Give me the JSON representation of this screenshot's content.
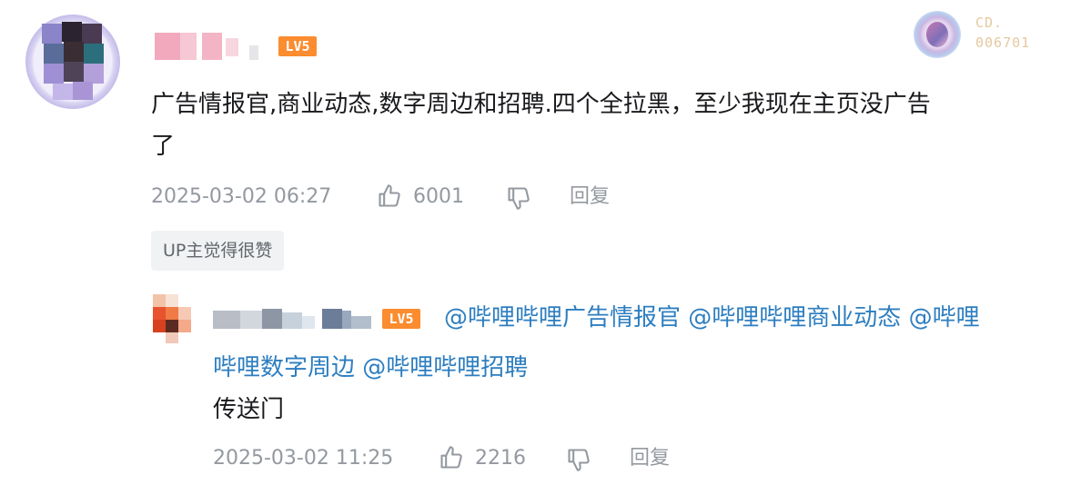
{
  "comment": {
    "level_badge": "LV5",
    "fan_badge_number": "CD.\n006701",
    "text_line1": "广告情报官,商业动态,数字周边和招聘.四个全拉黑，至少我现在主页没广告",
    "text_line2": "了",
    "timestamp": "2025-03-02 06:27",
    "like_count": "6001",
    "reply_label": "回复",
    "up_liked_tag": "UP主觉得很赞"
  },
  "reply": {
    "level_badge": "LV5",
    "mention_1": "@哔哩哔哩广告情报官",
    "mention_2": "@哔哩哔哩商业动态",
    "mention_3_part1": "@哔哩",
    "mention_3_part2": "哔哩数字周边",
    "mention_4": "@哔哩哔哩招聘",
    "text": "传送门",
    "timestamp": "2025-03-02 11:25",
    "like_count": "2216",
    "reply_label": "回复"
  },
  "colors": {
    "level_badge": "#fb8c2f",
    "mention_link": "#2d7ec0",
    "meta_text": "#9499a0",
    "tag_background": "#f1f2f3"
  },
  "icons": [
    "thumbs-up-icon",
    "thumbs-down-icon"
  ]
}
